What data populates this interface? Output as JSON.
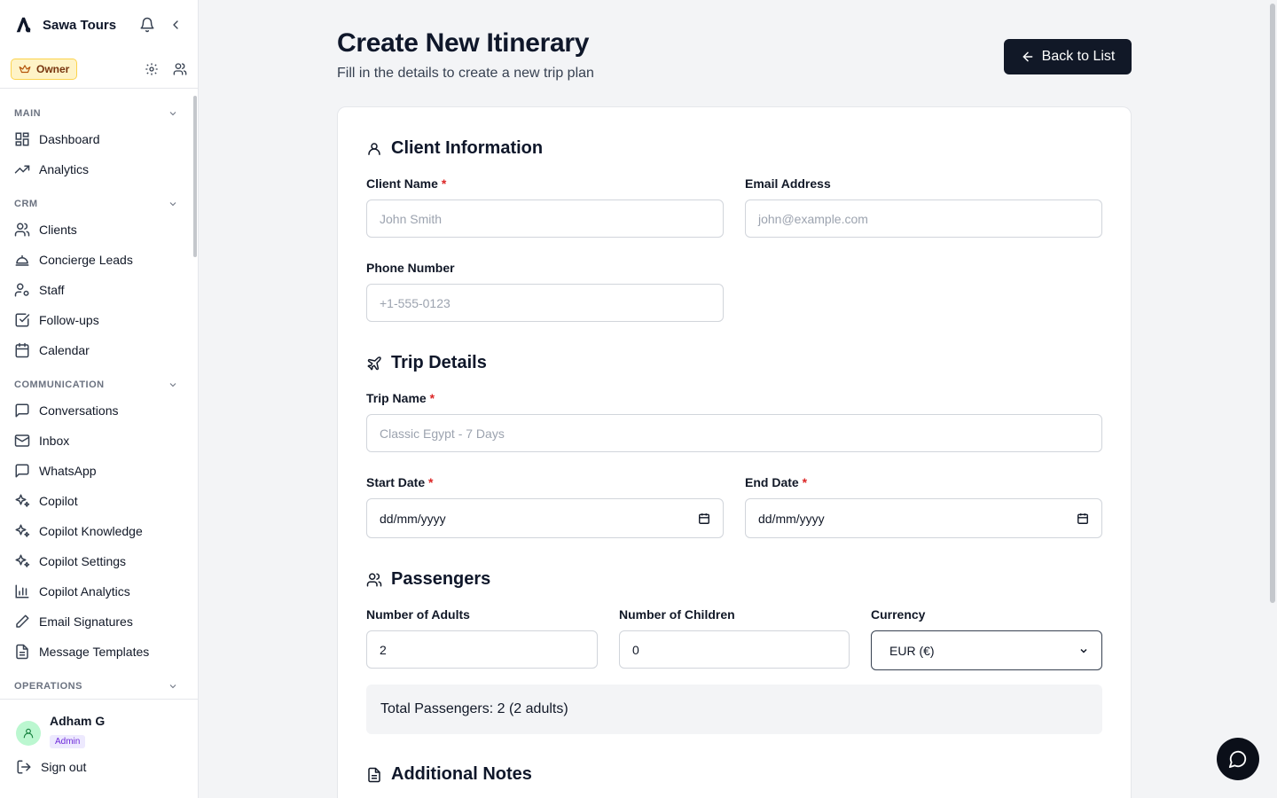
{
  "app": {
    "name": "Sawa Tours",
    "role_badge": "Owner"
  },
  "sidebar": {
    "sections": [
      {
        "title": "MAIN",
        "items": [
          {
            "label": "Dashboard",
            "icon": "dashboard-grid-icon"
          },
          {
            "label": "Analytics",
            "icon": "trending-up-icon"
          }
        ]
      },
      {
        "title": "CRM",
        "items": [
          {
            "label": "Clients",
            "icon": "users-icon"
          },
          {
            "label": "Concierge Leads",
            "icon": "concierge-bell-icon"
          },
          {
            "label": "Staff",
            "icon": "user-cog-icon"
          },
          {
            "label": "Follow-ups",
            "icon": "check-square-icon"
          },
          {
            "label": "Calendar",
            "icon": "calendar-icon"
          }
        ]
      },
      {
        "title": "COMMUNICATION",
        "items": [
          {
            "label": "Conversations",
            "icon": "message-square-icon"
          },
          {
            "label": "Inbox",
            "icon": "mail-icon"
          },
          {
            "label": "WhatsApp",
            "icon": "message-square-icon"
          },
          {
            "label": "Copilot",
            "icon": "sparkles-icon"
          },
          {
            "label": "Copilot Knowledge",
            "icon": "sparkles-icon"
          },
          {
            "label": "Copilot Settings",
            "icon": "sparkles-icon"
          },
          {
            "label": "Copilot Analytics",
            "icon": "bar-chart-icon"
          },
          {
            "label": "Email Signatures",
            "icon": "pen-icon"
          },
          {
            "label": "Message Templates",
            "icon": "file-text-icon"
          }
        ]
      },
      {
        "title": "OPERATIONS",
        "items": []
      }
    ]
  },
  "user": {
    "name": "Adham G",
    "badge": "Admin",
    "signout_label": "Sign out"
  },
  "page": {
    "title": "Create New Itinerary",
    "subtitle": "Fill in the details to create a new trip plan",
    "back_label": "Back to List"
  },
  "form": {
    "client": {
      "title": "Client Information",
      "name_label": "Client Name",
      "name_placeholder": "John Smith",
      "email_label": "Email Address",
      "email_placeholder": "john@example.com",
      "phone_label": "Phone Number",
      "phone_placeholder": "+1-555-0123"
    },
    "trip": {
      "title": "Trip Details",
      "name_label": "Trip Name",
      "name_placeholder": "Classic Egypt - 7 Days",
      "start_label": "Start Date",
      "start_value": "dd/mm/yyyy",
      "end_label": "End Date",
      "end_value": "dd/mm/yyyy"
    },
    "passengers": {
      "title": "Passengers",
      "adults_label": "Number of Adults",
      "adults_value": "2",
      "children_label": "Number of Children",
      "children_value": "0",
      "currency_label": "Currency",
      "currency_value": "EUR (€)",
      "total_text": "Total Passengers: 2 (2 adults)"
    },
    "notes": {
      "title": "Additional Notes"
    },
    "required_mark": "*"
  }
}
